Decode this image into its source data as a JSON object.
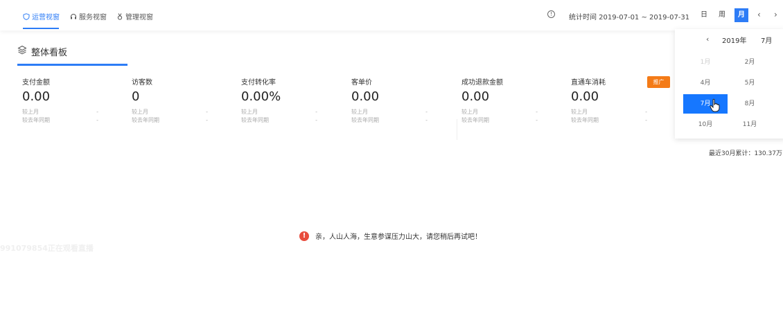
{
  "nav": {
    "tabs": [
      {
        "label": "运营视窗",
        "icon": "shield-icon",
        "active": true
      },
      {
        "label": "服务视窗",
        "icon": "headset-icon",
        "active": false
      },
      {
        "label": "管理视窗",
        "icon": "medal-icon",
        "active": false
      }
    ],
    "stat_time": "统计时间 2019-07-01 ~ 2019-07-31",
    "periods": [
      {
        "label": "日",
        "active": false
      },
      {
        "label": "周",
        "active": false
      },
      {
        "label": "月",
        "active": true
      }
    ],
    "prev": "‹",
    "next": "›"
  },
  "board": {
    "icon": "layers-icon",
    "title": "整体看板"
  },
  "metrics": [
    {
      "label": "支付金额",
      "value": "0.00",
      "mom_label": "较上月",
      "mom": "-",
      "yoy_label": "较去年同期",
      "yoy": "-"
    },
    {
      "label": "访客数",
      "value": "0",
      "mom_label": "较上月",
      "mom": "-",
      "yoy_label": "较去年同期",
      "yoy": "-"
    },
    {
      "label": "支付转化率",
      "value": "0.00%",
      "mom_label": "较上月",
      "mom": "-",
      "yoy_label": "较去年同期",
      "yoy": "-"
    },
    {
      "label": "客单价",
      "value": "0.00",
      "mom_label": "较上月",
      "mom": "-",
      "yoy_label": "较去年同期",
      "yoy": "-"
    },
    {
      "label": "成功退款金额",
      "value": "0.00",
      "mom_label": "较上月",
      "mom": "-",
      "yoy_label": "较去年同期",
      "yoy": "-"
    },
    {
      "label": "直通车消耗",
      "value": "0.00",
      "mom_label": "较上月",
      "mom": "-",
      "yoy_label": "较去年同期",
      "yoy": "-"
    }
  ],
  "promo_badge": "推广",
  "picker": {
    "prev": "‹",
    "year": "2019年",
    "month": "7月",
    "months": [
      {
        "label": "1月",
        "state": "disabled"
      },
      {
        "label": "2月",
        "state": "normal"
      },
      {
        "label": "4月",
        "state": "normal"
      },
      {
        "label": "5月",
        "state": "normal"
      },
      {
        "label": "7月",
        "state": "selected"
      },
      {
        "label": "8月",
        "state": "normal"
      },
      {
        "label": "10月",
        "state": "normal"
      },
      {
        "label": "11月",
        "state": "normal"
      }
    ]
  },
  "accumulated": "最近30月累计：130.37万",
  "error": {
    "icon": "!",
    "text": "亲，人山人海，生意参谋压力山大，请您稍后再试吧！"
  },
  "watermark": "991079854正在观看直播",
  "colors": {
    "accent": "#2d7cf6",
    "promo": "#f47b17",
    "error": "#e84c3d"
  }
}
